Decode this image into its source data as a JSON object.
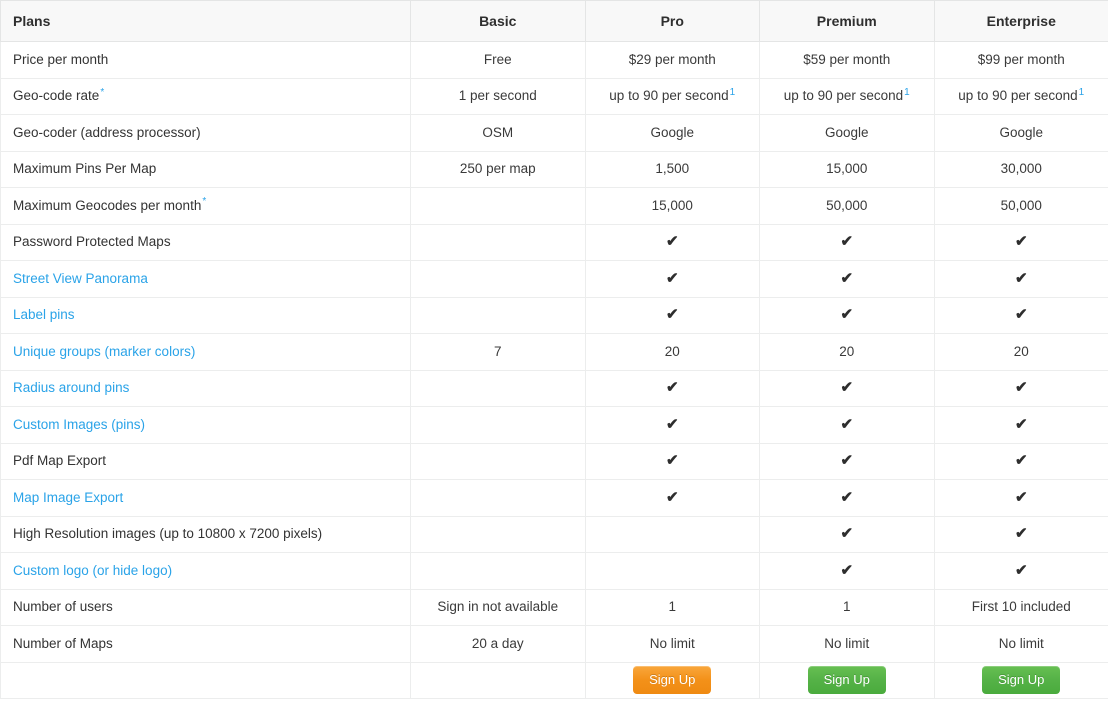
{
  "table": {
    "header": {
      "feature_label": "Plans",
      "plans": [
        "Basic",
        "Pro",
        "Premium",
        "Enterprise"
      ]
    },
    "rows": [
      {
        "label": "Price per month",
        "label_style": "plain",
        "marker": "",
        "values": [
          "Free",
          "$29 per month",
          "$59 per month",
          "$99 per month"
        ],
        "value_markers": [
          "",
          "",
          "",
          ""
        ]
      },
      {
        "label": "Geo-code rate",
        "label_style": "plain",
        "marker": "*",
        "values": [
          "1 per second",
          "up to 90 per second",
          "up to 90 per second",
          "up to 90 per second"
        ],
        "value_markers": [
          "",
          "1",
          "1",
          "1"
        ]
      },
      {
        "label": "Geo-coder (address processor)",
        "label_style": "plain",
        "marker": "",
        "values": [
          "OSM",
          "Google",
          "Google",
          "Google"
        ],
        "value_markers": [
          "",
          "",
          "",
          ""
        ]
      },
      {
        "label": "Maximum Pins Per Map",
        "label_style": "plain",
        "marker": "",
        "values": [
          "250 per map",
          "1,500",
          "15,000",
          "30,000"
        ],
        "value_markers": [
          "",
          "",
          "",
          ""
        ]
      },
      {
        "label": "Maximum Geocodes per month",
        "label_style": "plain",
        "marker": "*",
        "values": [
          "",
          "15,000",
          "50,000",
          "50,000"
        ],
        "value_markers": [
          "",
          "",
          "",
          ""
        ]
      },
      {
        "label": "Password Protected Maps",
        "label_style": "plain",
        "marker": "",
        "values": [
          "",
          "check",
          "check",
          "check"
        ],
        "value_markers": [
          "",
          "",
          "",
          ""
        ]
      },
      {
        "label": "Street View Panorama",
        "label_style": "link",
        "marker": "",
        "values": [
          "",
          "check",
          "check",
          "check"
        ],
        "value_markers": [
          "",
          "",
          "",
          ""
        ]
      },
      {
        "label": "Label pins",
        "label_style": "link",
        "marker": "",
        "values": [
          "",
          "check",
          "check",
          "check"
        ],
        "value_markers": [
          "",
          "",
          "",
          ""
        ]
      },
      {
        "label": "Unique groups (marker colors)",
        "label_style": "link",
        "marker": "",
        "values": [
          "7",
          "20",
          "20",
          "20"
        ],
        "value_markers": [
          "",
          "",
          "",
          ""
        ]
      },
      {
        "label": "Radius around pins",
        "label_style": "link",
        "marker": "",
        "values": [
          "",
          "check",
          "check",
          "check"
        ],
        "value_markers": [
          "",
          "",
          "",
          ""
        ]
      },
      {
        "label": "Custom Images (pins)",
        "label_style": "link",
        "marker": "",
        "values": [
          "",
          "check",
          "check",
          "check"
        ],
        "value_markers": [
          "",
          "",
          "",
          ""
        ]
      },
      {
        "label": "Pdf Map Export",
        "label_style": "plain",
        "marker": "",
        "values": [
          "",
          "check",
          "check",
          "check"
        ],
        "value_markers": [
          "",
          "",
          "",
          ""
        ]
      },
      {
        "label": "Map Image Export",
        "label_style": "link",
        "marker": "",
        "values": [
          "",
          "check",
          "check",
          "check"
        ],
        "value_markers": [
          "",
          "",
          "",
          ""
        ]
      },
      {
        "label": "High Resolution images (up to 10800 x 7200 pixels)",
        "label_style": "plain",
        "marker": "",
        "values": [
          "",
          "",
          "check",
          "check"
        ],
        "value_markers": [
          "",
          "",
          "",
          ""
        ]
      },
      {
        "label": "Custom logo (or hide logo)",
        "label_style": "link",
        "marker": "",
        "values": [
          "",
          "",
          "check",
          "check"
        ],
        "value_markers": [
          "",
          "",
          "",
          ""
        ]
      },
      {
        "label": "Number of users",
        "label_style": "plain",
        "marker": "",
        "values": [
          "Sign in not available",
          "1",
          "1",
          "First 10 included"
        ],
        "value_markers": [
          "",
          "",
          "",
          ""
        ]
      },
      {
        "label": "Number of Maps",
        "label_style": "plain",
        "marker": "",
        "values": [
          "20 a day",
          "No limit",
          "No limit",
          "No limit"
        ],
        "value_markers": [
          "",
          "",
          "",
          ""
        ]
      }
    ],
    "signup_row": {
      "label": "",
      "buttons": [
        {
          "label": "",
          "color": "none"
        },
        {
          "label": "Sign Up",
          "color": "orange"
        },
        {
          "label": "Sign Up",
          "color": "green"
        },
        {
          "label": "Sign Up",
          "color": "green"
        }
      ]
    }
  },
  "icons": {
    "check": "✔"
  },
  "colors": {
    "link": "#2aa3e8",
    "marker": "#2aa3e8",
    "button_orange": "#f39119",
    "button_green": "#55b247",
    "header_bg": "#f8f8f8",
    "border": "#eceded",
    "text": "#333333"
  }
}
